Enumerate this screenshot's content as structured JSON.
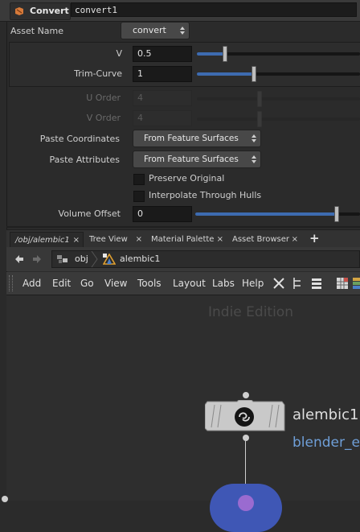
{
  "header": {
    "node_type": "Convert",
    "node_name": "convert1"
  },
  "params": {
    "asset_name_label": "Asset Name",
    "asset_name_value": "convert",
    "v_label": "V",
    "v_value": "0.5",
    "v_level": 0.17,
    "trim_label": "Trim-Curve",
    "trim_value": "1",
    "trim_level": 0.35,
    "u_order_label": "U Order",
    "u_order_value": "4",
    "v_order_label": "V Order",
    "v_order_value": "4",
    "paste_coords_label": "Paste Coordinates",
    "paste_coords_value": "From Feature Surfaces",
    "paste_attrs_label": "Paste Attributes",
    "paste_attrs_value": "From Feature Surfaces",
    "preserve_label": "Preserve Original",
    "interp_label": "Interpolate Through Hulls",
    "volume_label": "Volume Offset",
    "volume_value": "0",
    "volume_level": 0.86
  },
  "tabs": [
    "/obj/alembic1",
    "Tree View",
    "Material Palette",
    "Asset Browser"
  ],
  "tab_add": "+",
  "nav": {
    "path_1": "obj",
    "path_2": "alembic1"
  },
  "menu": [
    "Add",
    "Edit",
    "Go",
    "View",
    "Tools",
    "Layout",
    "Labs",
    "Help"
  ],
  "network": {
    "watermark": "Indie Edition",
    "node_name": "alembic1",
    "node_subtitle": "blender_e"
  },
  "colors": {
    "accent": "#3d6bb0",
    "node_subtitle": "#6f9fd8"
  }
}
